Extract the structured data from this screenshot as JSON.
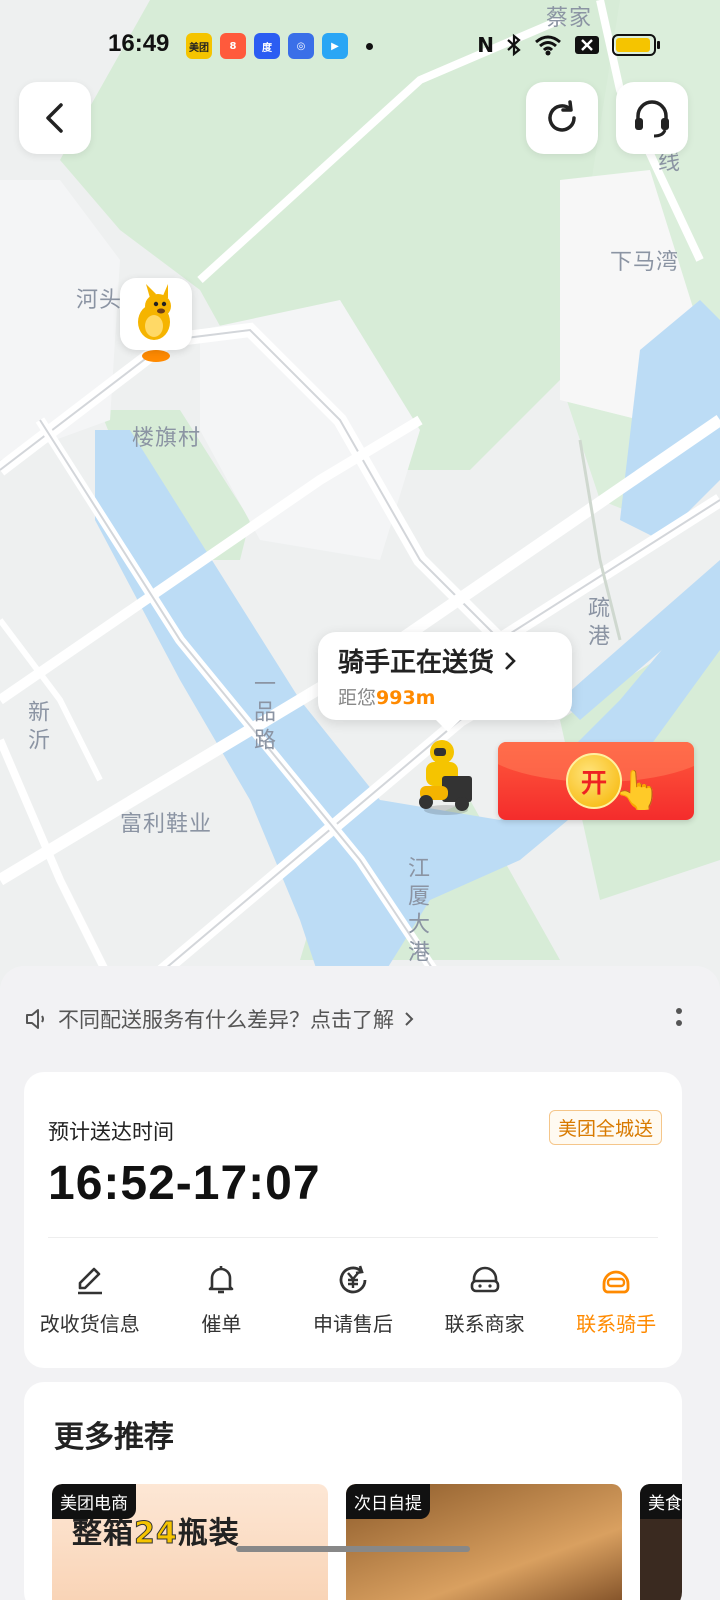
{
  "status_bar": {
    "time": "16:49",
    "notification_apps": [
      {
        "name": "meituan-app",
        "label": "美团",
        "color": "#f5c400"
      },
      {
        "name": "app-2",
        "label": "8",
        "color": "#ff5a3c"
      },
      {
        "name": "baidu-app",
        "label": "度",
        "color": "#2b5df2"
      },
      {
        "name": "app-4",
        "label": "◎",
        "color": "#3a6fe8"
      },
      {
        "name": "app-5",
        "label": "▶",
        "color": "#2aa6f5"
      }
    ],
    "battery_level": 0.95
  },
  "map": {
    "labels": {
      "caijia": "蔡家",
      "xian": "线",
      "xiamawan": "下马湾",
      "hetou": "河头",
      "louqicun": "楼旗村",
      "shu": "疏港",
      "xin": "新沂",
      "road": "一品路",
      "fulixieye": "富利鞋业",
      "jiangxia": "江厦大港"
    }
  },
  "rider": {
    "status": "骑手正在送货",
    "distance_prefix": "距您",
    "distance_value": "993m"
  },
  "red_packet": {
    "open_label": "开"
  },
  "notice": {
    "text": "不同配送服务有什么差异？点击了解"
  },
  "delivery": {
    "eta_label": "预计送达时间",
    "eta_time": "16:52-17:07",
    "service_badge": "美团全城送"
  },
  "actions": [
    {
      "label": "改收货信息",
      "icon": "pencil-icon"
    },
    {
      "label": "催单",
      "icon": "bell-icon"
    },
    {
      "label": "申请售后",
      "icon": "yuan-refresh-icon"
    },
    {
      "label": "联系商家",
      "icon": "merchant-headset-icon"
    },
    {
      "label": "联系骑手",
      "icon": "rider-helmet-icon",
      "active": true
    }
  ],
  "recommend": {
    "title": "更多推荐",
    "items": [
      {
        "tag": "美团电商",
        "headline_part1": "整箱",
        "headline_num": "24",
        "headline_part2": "瓶装"
      },
      {
        "tag": "次日自提"
      },
      {
        "tag": "美食"
      }
    ]
  },
  "colors": {
    "accent": "#ff8a00",
    "water": "#bcdcf5",
    "green": "#d7ecd7"
  }
}
